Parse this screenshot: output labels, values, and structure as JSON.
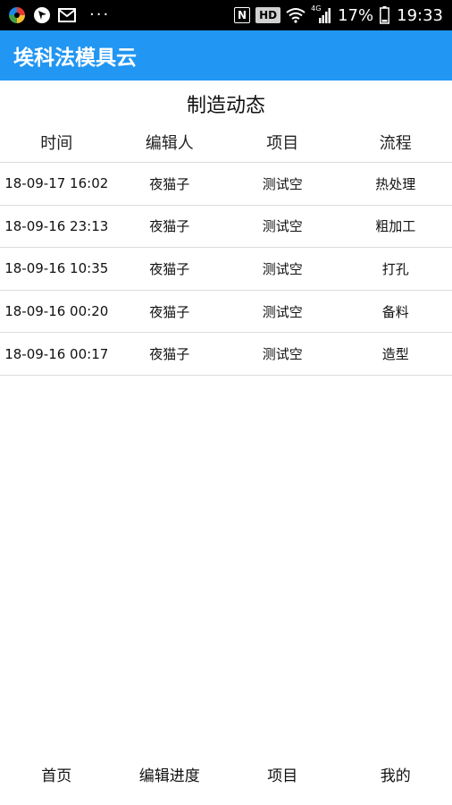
{
  "status_bar": {
    "left_icons": [
      "app-pinwheel-icon",
      "navigation-arrow-icon",
      "mail-icon"
    ],
    "more_indicator": "···",
    "nfc_badge": "N",
    "hd_badge": "HD",
    "network_label": "4G",
    "battery_percent": "17%",
    "time": "19:33"
  },
  "app_bar": {
    "title": "埃科法模具云",
    "background_color": "#2196F3"
  },
  "section": {
    "title": "制造动态"
  },
  "table": {
    "headers": [
      "时间",
      "编辑人",
      "项目",
      "流程"
    ],
    "rows": [
      [
        "18-09-17 16:02",
        "夜猫子",
        "测试空",
        "热处理"
      ],
      [
        "18-09-16 23:13",
        "夜猫子",
        "测试空",
        "粗加工"
      ],
      [
        "18-09-16 10:35",
        "夜猫子",
        "测试空",
        "打孔"
      ],
      [
        "18-09-16 00:20",
        "夜猫子",
        "测试空",
        "备料"
      ],
      [
        "18-09-16 00:17",
        "夜猫子",
        "测试空",
        "造型"
      ]
    ]
  },
  "bottom_nav": {
    "items": [
      "首页",
      "编辑进度",
      "项目",
      "我的"
    ]
  }
}
